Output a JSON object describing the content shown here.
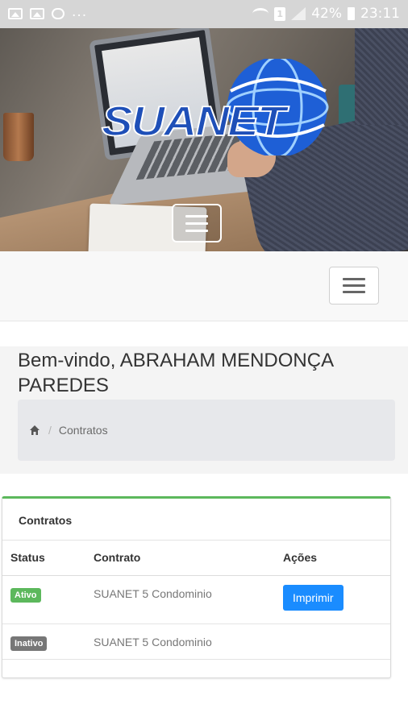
{
  "status_bar": {
    "dots": "...",
    "battery": "42%",
    "time": "23:11",
    "sim": "1",
    "icons": [
      "image-icon",
      "photo-icon",
      "key-icon",
      "wifi-icon",
      "sim-icon",
      "signal-icon",
      "battery-icon"
    ]
  },
  "brand": {
    "logo_text": "SUANET"
  },
  "welcome": "Bem-vindo, ABRAHAM MENDONÇA PAREDES",
  "breadcrumb": {
    "home_icon": "home-icon",
    "current": "Contratos"
  },
  "panel": {
    "title": "Contratos",
    "columns": [
      "Status",
      "Contrato",
      "Ações"
    ],
    "rows": [
      {
        "status": "Ativo",
        "status_color": "#5cb85c",
        "contract": "SUANET 5 Condominio",
        "action": "Imprimir"
      },
      {
        "status": "Inativo",
        "status_color": "#777777",
        "contract": "SUANET 5 Condominio",
        "action": ""
      }
    ],
    "accent_color": "#5cb85c"
  },
  "colors": {
    "print_button": "#1a8cff",
    "logo_blue": "#1e4fb8"
  }
}
